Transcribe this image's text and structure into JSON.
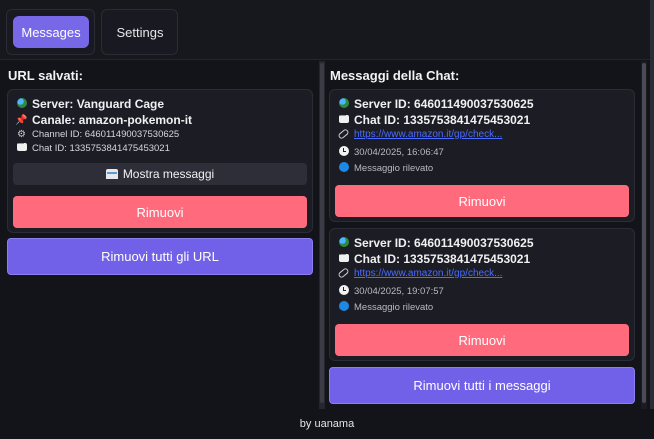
{
  "tabs": [
    {
      "label": "Messages",
      "active": true
    },
    {
      "label": "Settings",
      "active": false
    }
  ],
  "left_panel": {
    "title": "URL salvati:",
    "cards": [
      {
        "server": "Server: Vanguard Cage",
        "channel": "Canale: amazon-pokemon-it",
        "channel_id": "Channel ID: 646011490037530625",
        "chat_id": "Chat ID: 1335753841475453021",
        "show_button": "Mostra messaggi",
        "remove_button": "Rimuovi"
      }
    ],
    "remove_all_button": "Rimuovi tutti gli URL"
  },
  "right_panel": {
    "title": "Messaggi della Chat:",
    "messages": [
      {
        "server_id": "Server ID: 646011490037530625",
        "chat_id": "Chat ID: 1335753841475453021",
        "url": "https://www.amazon.it/gp/check...",
        "timestamp": "30/04/2025, 16:06:47",
        "status": "Messaggio rilevato",
        "remove_button": "Rimuovi"
      },
      {
        "server_id": "Server ID: 646011490037530625",
        "chat_id": "Chat ID: 1335753841475453021",
        "url": "https://www.amazon.it/gp/check...",
        "timestamp": "30/04/2025, 19:07:57",
        "status": "Messaggio rilevato",
        "remove_button": "Rimuovi"
      }
    ],
    "remove_all_button": "Rimuovi tutti i messaggi"
  },
  "footer": {
    "text": "by uanama"
  },
  "colors": {
    "accent": "#7768e8",
    "danger": "#ff6b7d",
    "link": "#4a6bff",
    "background": "#131419"
  },
  "icons": {
    "globe": "globe-icon",
    "pin": "pushpin-icon",
    "bot": "bot-icon",
    "chat": "chat-bubble-icon",
    "link": "link-icon",
    "clock": "clock-icon",
    "status": "blue-circle-icon",
    "mailbox": "mailbox-icon"
  }
}
